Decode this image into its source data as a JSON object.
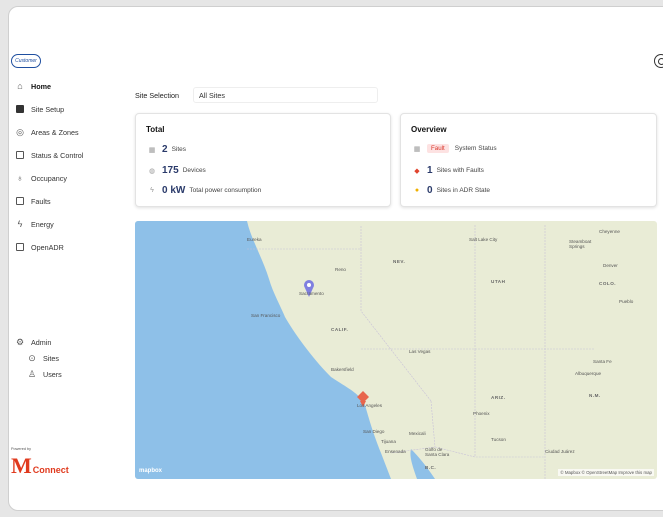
{
  "app": {
    "logo_text": "Customer",
    "settings_icon": "settings-icon"
  },
  "sidebar": {
    "items": [
      {
        "label": "Home",
        "icon": "home-icon",
        "active": true
      },
      {
        "label": "Site Setup",
        "icon": "grid-icon"
      },
      {
        "label": "Areas & Zones",
        "icon": "zones-icon"
      },
      {
        "label": "Status & Control",
        "icon": "control-icon"
      },
      {
        "label": "Occupancy",
        "icon": "pin-icon"
      },
      {
        "label": "Faults",
        "icon": "fault-box-icon"
      },
      {
        "label": "Energy",
        "icon": "bolt-icon"
      },
      {
        "label": "OpenADR",
        "icon": "monitor-icon"
      }
    ],
    "admin": {
      "label": "Admin",
      "items": [
        {
          "label": "Sites",
          "icon": "location-icon"
        },
        {
          "label": "Users",
          "icon": "users-icon"
        }
      ]
    },
    "brand": {
      "powered_by": "Powered by",
      "mark": "M",
      "name": "Connect"
    }
  },
  "site_selection": {
    "label": "Site Selection",
    "value": "All Sites"
  },
  "total": {
    "title": "Total",
    "sites_value": "2",
    "sites_label": "Sites",
    "devices_value": "175",
    "devices_label": "Devices",
    "power_value": "0 kW",
    "power_label": "Total power consumption"
  },
  "overview": {
    "title": "Overview",
    "status_pill": "Fault",
    "status_label": "System Status",
    "faults_value": "1",
    "faults_label": "Sites with Faults",
    "adr_value": "0",
    "adr_label": "Sites in ADR State"
  },
  "map": {
    "cities": [
      "Eureka",
      "Reno",
      "Sacramento",
      "San Francisco",
      "Bakersfield",
      "Las Vegas",
      "Los Angeles",
      "San Diego",
      "Mexicali",
      "Tijuana",
      "Ensenada",
      "Golfo de Santa Clara",
      "Phoenix",
      "Tucson",
      "Ciudad Juárez",
      "Salt Lake City",
      "Steamboat Springs",
      "Denver",
      "Cheyenne",
      "Pueblo",
      "Santa Fe",
      "Albuquerque"
    ],
    "states": [
      "NEV.",
      "UTAH",
      "COLO.",
      "CALIF.",
      "ARIZ.",
      "N.M.",
      "B.C."
    ],
    "logo": "mapbox",
    "attribution": "© Mapbox © OpenStreetMap Improve this map",
    "colors": {
      "ocean": "#8ec0e8",
      "land": "#e9ecd6",
      "pin_site": "#7f7fe0",
      "pin_fault": "#e8664d"
    }
  }
}
